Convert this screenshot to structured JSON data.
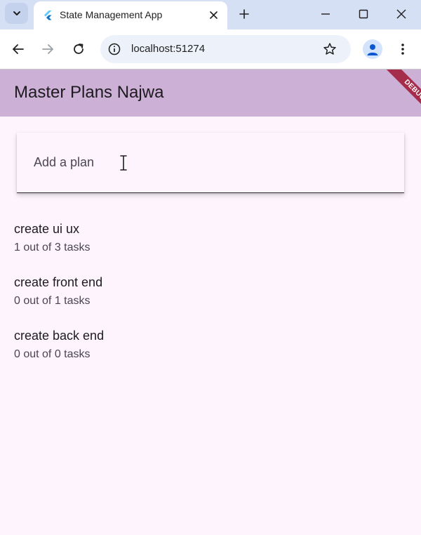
{
  "browser": {
    "tab_title": "State Management App",
    "url": "localhost:51274"
  },
  "app": {
    "title": "Master Plans Najwa",
    "debug_label": "DEBUG",
    "input_placeholder": "Add a plan",
    "plans": [
      {
        "name": "create ui ux",
        "progress": "1 out of 3 tasks"
      },
      {
        "name": "create front end",
        "progress": "0 out of 1 tasks"
      },
      {
        "name": "create back end",
        "progress": "0 out of 0 tasks"
      }
    ]
  },
  "colors": {
    "appbar": "#cdb0d6",
    "background": "#fdf4fd",
    "debug_ribbon": "#a62c4c",
    "tabstrip": "#d6e0f5"
  }
}
